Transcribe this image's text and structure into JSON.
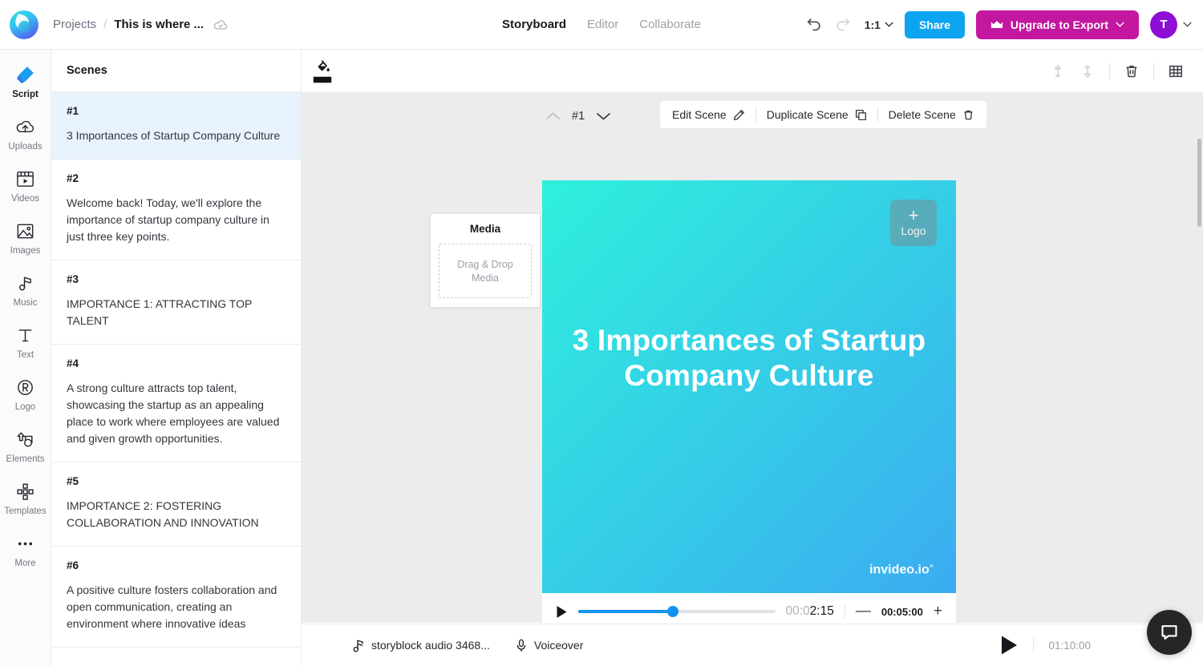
{
  "topbar": {
    "logo_icon": "invideo-logo",
    "breadcrumb": {
      "projects": "Projects",
      "separator": "/",
      "title": "This is where ...",
      "cloud_icon": "cloud-saved-icon"
    },
    "tabs": [
      {
        "label": "Storyboard",
        "active": true
      },
      {
        "label": "Editor",
        "active": false
      },
      {
        "label": "Collaborate",
        "active": false
      }
    ],
    "undo_icon": "undo-icon",
    "redo_icon": "redo-icon",
    "ratio": "1:1",
    "share_label": "Share",
    "upgrade_label": "Upgrade to Export",
    "crown_icon": "crown-icon",
    "avatar_initial": "T",
    "accent_blue": "#0ea5f0",
    "accent_magenta": "#c4179f",
    "avatar_purple": "#8d0fd6"
  },
  "rail": {
    "items": [
      {
        "label": "Script",
        "icon": "script-icon",
        "active": true
      },
      {
        "label": "Uploads",
        "icon": "upload-cloud-icon",
        "active": false
      },
      {
        "label": "Videos",
        "icon": "video-icon",
        "active": false
      },
      {
        "label": "Images",
        "icon": "image-icon",
        "active": false
      },
      {
        "label": "Music",
        "icon": "music-note-icon",
        "active": false
      },
      {
        "label": "Text",
        "icon": "text-icon",
        "active": false
      },
      {
        "label": "Logo",
        "icon": "registered-logo-icon",
        "active": false
      },
      {
        "label": "Elements",
        "icon": "shapes-icon",
        "active": false
      },
      {
        "label": "Templates",
        "icon": "templates-grid-icon",
        "active": false
      },
      {
        "label": "More",
        "icon": "more-dots-icon",
        "active": false
      }
    ]
  },
  "scenes": {
    "header": "Scenes",
    "list": [
      {
        "num": "#1",
        "text": "3 Importances of Startup Company Culture",
        "selected": true
      },
      {
        "num": "#2",
        "text": "Welcome back! Today, we'll explore the importance of startup company culture in just three key points.",
        "selected": false
      },
      {
        "num": "#3",
        "text": "IMPORTANCE 1: ATTRACTING TOP TALENT",
        "selected": false
      },
      {
        "num": "#4",
        "text": "A strong culture attracts top talent, showcasing the startup as an appealing place to work where employees are valued and given growth opportunities.",
        "selected": false
      },
      {
        "num": "#5",
        "text": "IMPORTANCE 2: FOSTERING COLLABORATION AND INNOVATION",
        "selected": false
      },
      {
        "num": "#6",
        "text": "A positive culture fosters collaboration and open communication, creating an environment where innovative ideas",
        "selected": false
      }
    ]
  },
  "canvas": {
    "toolbar": {
      "fill_icon": "paint-bucket-icon",
      "fill_color": "#111418",
      "move_up_icon": "move-up-icon",
      "move_down_icon": "move-down-icon",
      "delete_icon": "trash-icon",
      "grid_icon": "grid-icon"
    },
    "scene_nav": {
      "up_icon": "chevron-up-icon",
      "number": "#1",
      "down_icon": "chevron-down-icon"
    },
    "actions": [
      {
        "label": "Edit Scene",
        "icon": "pencil-icon"
      },
      {
        "label": "Duplicate Scene",
        "icon": "copy-icon"
      },
      {
        "label": "Delete Scene",
        "icon": "trash-icon"
      }
    ],
    "media_panel": {
      "title": "Media",
      "drop_line1": "Drag & Drop",
      "drop_line2": "Media"
    },
    "video": {
      "logo_placeholder": {
        "plus": "+",
        "label": "Logo"
      },
      "title": "3 Importances of Startup Company Culture",
      "watermark": "invideo.io",
      "watermark_sup": "×",
      "gradient_start": "#2ef0dc",
      "gradient_end": "#3bacf1"
    },
    "player": {
      "play_icon": "play-icon",
      "current_time_dim": "00:0",
      "current_time": "2:15",
      "progress_percent": 48,
      "minus": "—",
      "duration": "00:05:00",
      "plus": "+"
    },
    "add_scene": "+"
  },
  "bottombar": {
    "audio_icon": "music-note-icon",
    "audio_label": "storyblock audio 3468...",
    "voiceover_icon": "microphone-icon",
    "voiceover_label": "Voiceover",
    "play_icon": "play-icon",
    "total_time": "01:10:00"
  },
  "chat": {
    "icon": "chat-bubble-icon"
  }
}
